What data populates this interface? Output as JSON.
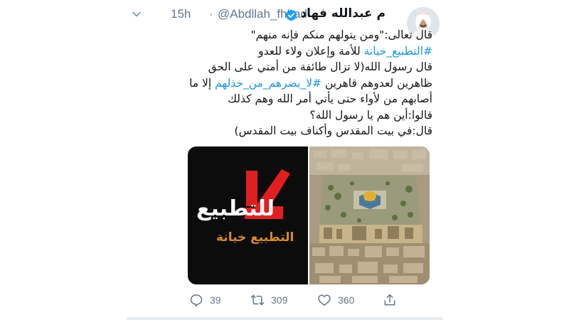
{
  "tweet": {
    "author": {
      "display_name": "م عبدالله فهاد",
      "handle": "@Abdllah_fhhad",
      "time": "15h",
      "separator": "·"
    },
    "text_lines": [
      {
        "parts": [
          {
            "t": "قال تعالى:\"ومن يتولهم منكم فإنه منهم\"",
            "h": false
          }
        ]
      },
      {
        "parts": [
          {
            "t": "#التطبيع_خيانة",
            "h": true
          },
          {
            "t": " للأمة وإعلان ولاء للعدو",
            "h": false
          }
        ]
      },
      {
        "parts": [
          {
            "t": "قال رسول الله(لا تزال طائفة من أمتي على الحق",
            "h": false
          }
        ]
      },
      {
        "parts": [
          {
            "t": "ظاهرين لعدوهم قاهرين ",
            "h": false
          },
          {
            "t": "#لا_يضرهم_من_خذلهم",
            "h": true
          },
          {
            "t": " إلا ما",
            "h": false
          }
        ]
      },
      {
        "parts": [
          {
            "t": "أصابهم من لأواء حتى يأتي أمر الله وهم كذلك",
            "h": false
          }
        ]
      },
      {
        "parts": [
          {
            "t": "قالوا:أين هم يا رسول الله؟",
            "h": false
          }
        ]
      },
      {
        "parts": [
          {
            "t": "قال:في بيت المقدس وأكناف بيت المقدس)",
            "h": false
          }
        ]
      }
    ],
    "media": {
      "left_image": {
        "main_text": "للتطبيع",
        "la_text": "لا",
        "sub_text": "التطبيع خيانة"
      },
      "right_image": {
        "description_icon": "jerusalem-aerial-photo"
      }
    },
    "actions": {
      "replies": "39",
      "retweets": "309",
      "likes": "360"
    }
  },
  "colors": {
    "link": "#1b95e0",
    "meta": "#657786",
    "verified": "#1da1f2",
    "la_red": "#e02020",
    "slogan_orange": "#d88a2a"
  }
}
